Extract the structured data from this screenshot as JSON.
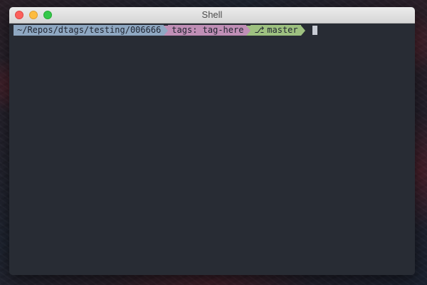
{
  "window": {
    "title": "Shell"
  },
  "prompt": {
    "path": "~/Repos/dtags/testing/006666",
    "tags": "tags: tag-here",
    "branch_icon": "⎇",
    "branch": "master"
  },
  "colors": {
    "terminal_bg": "#282c34",
    "path_segment": "#8fa8c2",
    "tags_segment": "#c08fb6",
    "branch_segment": "#9ec180"
  }
}
